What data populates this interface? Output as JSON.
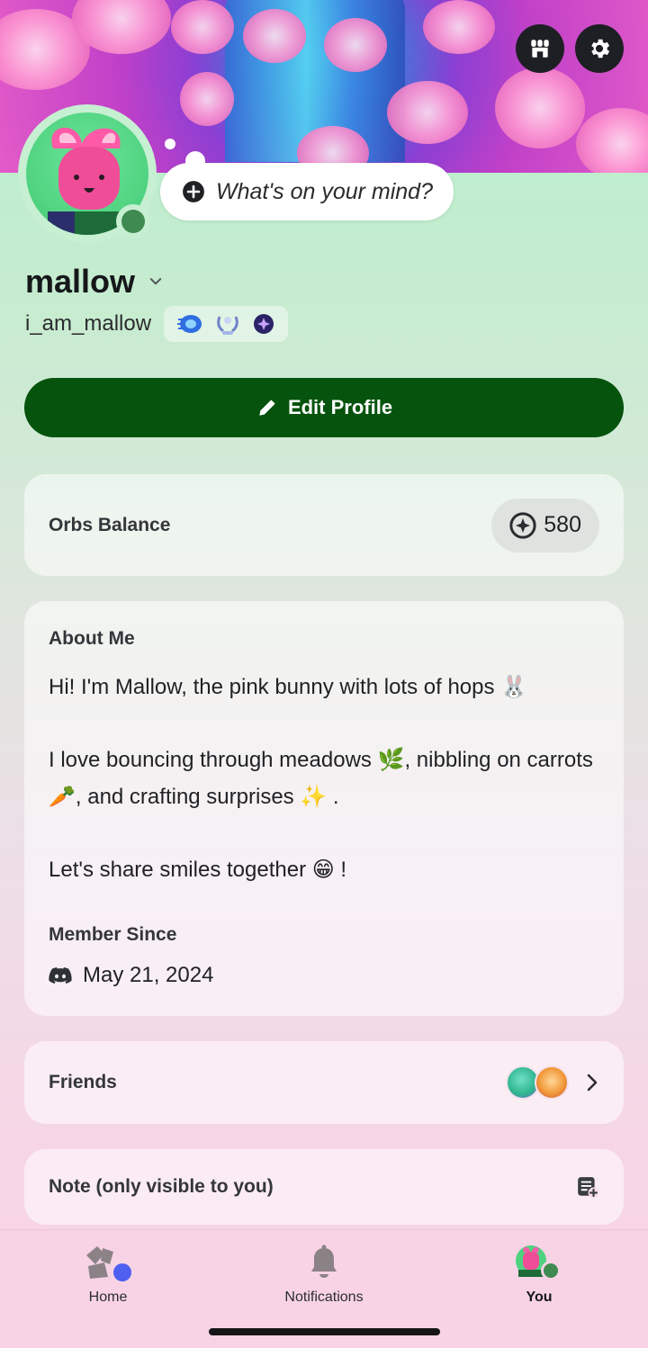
{
  "header": {
    "shop_icon": "shop-icon",
    "settings_icon": "gear-icon"
  },
  "status": {
    "prompt_text": "What's on your mind?"
  },
  "profile": {
    "display_name": "mallow",
    "username": "i_am_mallow",
    "badges": [
      "nitro-badge",
      "boost-badge",
      "quest-badge"
    ],
    "status_color": "#3f8a50"
  },
  "actions": {
    "edit_profile_label": "Edit Profile",
    "edit_profile_color": "#05530d"
  },
  "orbs": {
    "label": "Orbs Balance",
    "value": "580"
  },
  "about": {
    "heading": "About Me",
    "text": "Hi! I'm Mallow, the pink bunny with lots of hops 🐰\n\nI love bouncing through meadows 🌿, nibbling on carrots 🥕, and crafting surprises ✨ .\n\nLet's share smiles together 😁 !",
    "member_since_label": "Member Since",
    "member_since_date": "May 21, 2024"
  },
  "friends": {
    "label": "Friends"
  },
  "note": {
    "label": "Note (only visible to you)"
  },
  "nav": {
    "home": "Home",
    "notifications": "Notifications",
    "you": "You",
    "active": "You"
  }
}
